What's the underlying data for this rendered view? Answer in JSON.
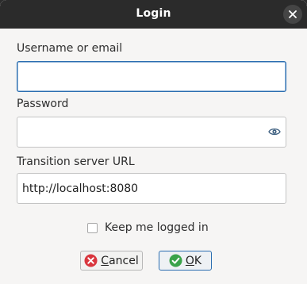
{
  "window": {
    "title": "Login",
    "close_icon": "close-icon"
  },
  "form": {
    "username": {
      "label": "Username or email",
      "value": "",
      "placeholder": ""
    },
    "password": {
      "label": "Password",
      "value": "",
      "placeholder": "",
      "reveal_icon": "eye-icon"
    },
    "server_url": {
      "label": "Transition server URL",
      "value": "http://localhost:8080",
      "placeholder": ""
    },
    "keep_logged_in": {
      "label": "Keep me logged in",
      "checked": false
    }
  },
  "buttons": {
    "cancel": {
      "mnemonic": "C",
      "rest": "ancel",
      "icon": "cancel-icon",
      "color": "#d9363e"
    },
    "ok": {
      "mnemonic": "O",
      "rest": "K",
      "icon": "check-icon",
      "color": "#3aa34a"
    }
  },
  "colors": {
    "titlebar": "#2b2b2b",
    "focus": "#2a6db0",
    "background": "#f6f5f4"
  }
}
